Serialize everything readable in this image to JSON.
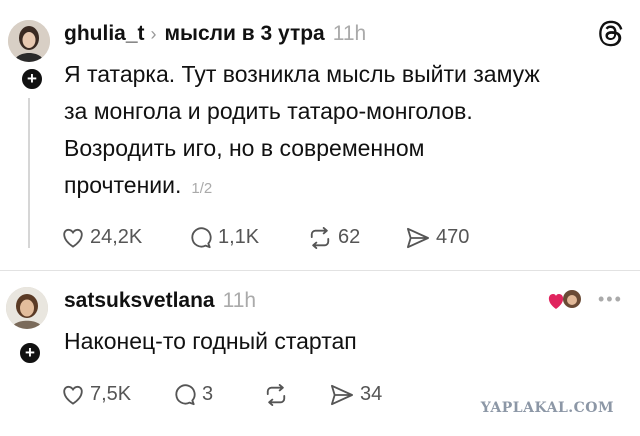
{
  "post1": {
    "username": "ghulia_t",
    "topic": "мысли в 3 утра",
    "time": "11h",
    "text_lines": [
      "Я татарка. Тут возникла мысль выйти замуж",
      "за монгола и родить татаро-монголов.",
      "Возродить иго, но в современном",
      "прочтении."
    ],
    "page_indicator": "1/2",
    "likes": "24,2K",
    "replies": "1,1K",
    "reposts": "62",
    "shares": "470"
  },
  "post2": {
    "username": "satsuksvetlana",
    "time": "11h",
    "text": "Наконец-то годный стартап",
    "likes": "7,5K",
    "replies": "3",
    "reposts": "",
    "shares": "34"
  },
  "icons": {
    "threads": "threads-logo-icon",
    "like": "heart-icon",
    "reply": "comment-icon",
    "repost": "repost-icon",
    "share": "send-icon",
    "more": "more-icon"
  },
  "watermark": "YAPLAKAL.COM"
}
